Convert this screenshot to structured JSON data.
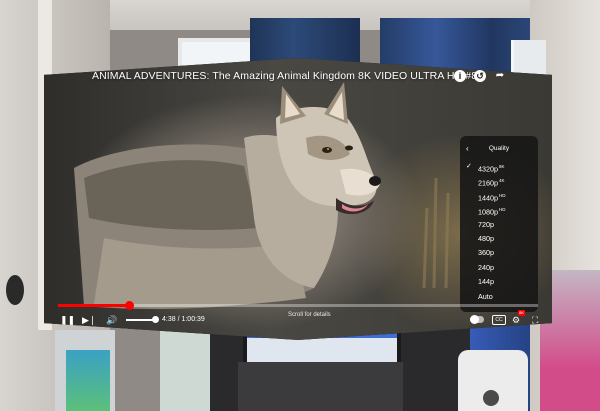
{
  "video": {
    "title": "ANIMAL ADVENTURES: The Amazing Animal Kingdom 8K VIDEO ULTRA HD #8K",
    "progress_fraction": 0.148,
    "volume_fraction": 0.9
  },
  "top_icons": {
    "info": "i",
    "history": "↺",
    "share": "➦"
  },
  "quality_menu": {
    "header": "Quality",
    "back": "‹",
    "selected_index": 0,
    "items": [
      {
        "label": "4320p",
        "badge": "8K"
      },
      {
        "label": "2160p",
        "badge": "4K"
      },
      {
        "label": "1440p",
        "badge": "HD"
      },
      {
        "label": "1080p",
        "badge": "HD"
      },
      {
        "label": "720p",
        "badge": ""
      },
      {
        "label": "480p",
        "badge": ""
      },
      {
        "label": "360p",
        "badge": ""
      },
      {
        "label": "240p",
        "badge": ""
      },
      {
        "label": "144p",
        "badge": ""
      },
      {
        "label": "Auto",
        "badge": ""
      }
    ]
  },
  "controls": {
    "time": "4:38 / 1:00:39",
    "scroll_hint": "Scroll for details",
    "cc": "CC",
    "hd_badge": "8K"
  }
}
